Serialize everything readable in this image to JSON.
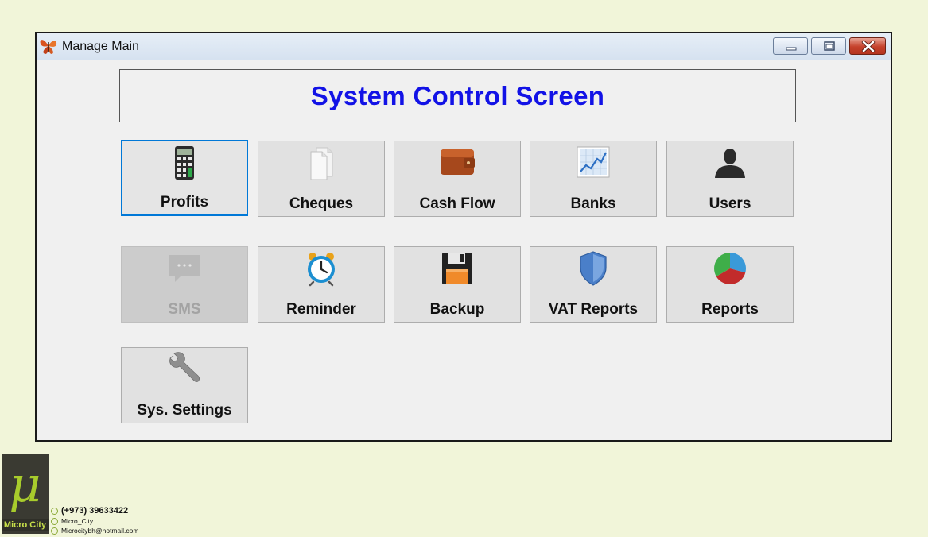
{
  "window": {
    "title": "Manage Main",
    "header_title": "System Control Screen"
  },
  "tiles": [
    {
      "label": "Profits",
      "icon": "calculator-icon",
      "state": "focused"
    },
    {
      "label": "Cheques",
      "icon": "documents-icon",
      "state": "normal"
    },
    {
      "label": "Cash Flow",
      "icon": "wallet-icon",
      "state": "normal"
    },
    {
      "label": "Banks",
      "icon": "chart-icon",
      "state": "normal"
    },
    {
      "label": "Users",
      "icon": "user-icon",
      "state": "normal"
    },
    {
      "label": "SMS",
      "icon": "chat-bubble-icon",
      "state": "disabled"
    },
    {
      "label": "Reminder",
      "icon": "alarm-clock-icon",
      "state": "normal"
    },
    {
      "label": "Backup",
      "icon": "floppy-disk-icon",
      "state": "normal"
    },
    {
      "label": "VAT Reports",
      "icon": "shield-icon",
      "state": "normal"
    },
    {
      "label": "Reports",
      "icon": "pie-chart-icon",
      "state": "normal"
    },
    {
      "label": "Sys. Settings",
      "icon": "wrench-icon",
      "state": "normal"
    }
  ],
  "branding": {
    "logo_glyph": "μ",
    "logo_name": "Micro City",
    "phone": "(+973) 39633422",
    "handle": "Micro_City",
    "email": "Microcitybh@hotmail.com"
  },
  "colors": {
    "header_text": "#1212e6",
    "focus_border": "#0078d7",
    "page_background": "#f1f5d9",
    "logo_accent": "#a8cc2c"
  }
}
